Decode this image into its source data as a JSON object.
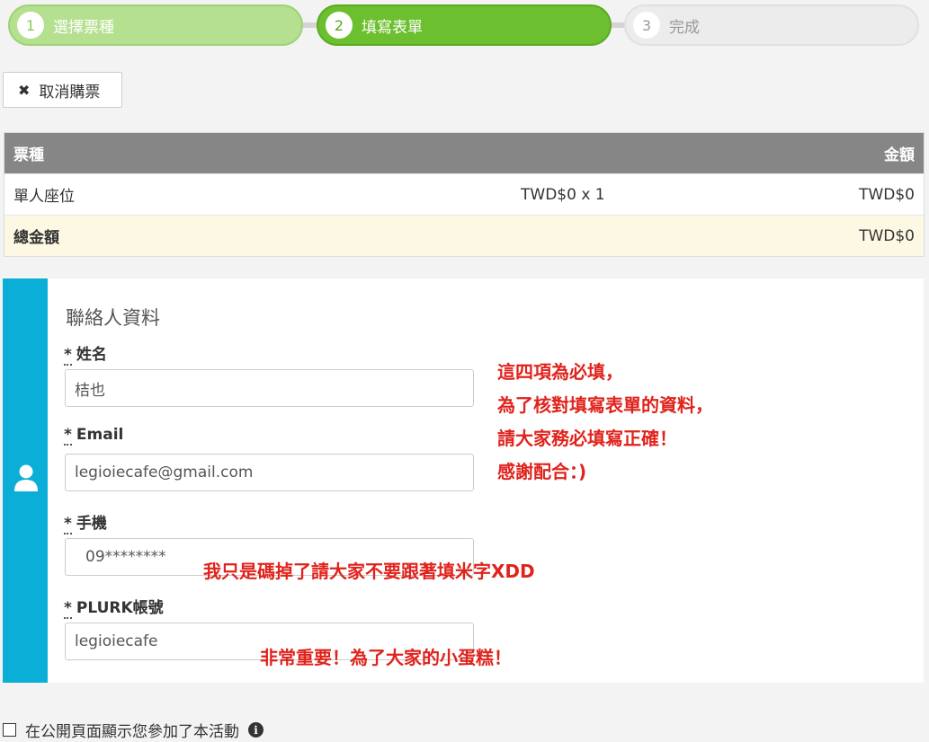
{
  "steps": [
    {
      "num": "1",
      "label": "選擇票種"
    },
    {
      "num": "2",
      "label": "填寫表單"
    },
    {
      "num": "3",
      "label": "完成"
    }
  ],
  "cancel_button": {
    "icon": "close-icon",
    "label": "取消購票"
  },
  "ticket_table": {
    "headers": {
      "type": "票種",
      "amount": "金額"
    },
    "rows": [
      {
        "type": "單人座位",
        "qty": "TWD$0 x 1",
        "amount": "TWD$0"
      }
    ],
    "total": {
      "label": "總金額",
      "amount": "TWD$0"
    }
  },
  "contact": {
    "title": "聯絡人資料",
    "fields": [
      {
        "required": "*",
        "label": "姓名",
        "value": "桔也"
      },
      {
        "required": "*",
        "label": "Email",
        "value": "legioiecafe@gmail.com"
      },
      {
        "required": "*",
        "label": "手機",
        "value": "09********"
      },
      {
        "required": "*",
        "label": "PLURK帳號",
        "value": "legioiecafe"
      }
    ],
    "annotations": {
      "required_note": [
        "這四項為必填，",
        "為了核對填寫表單的資料，",
        "請大家務必填寫正確！",
        "感謝配合：)"
      ],
      "phone_note": "我只是碼掉了請大家不要跟著填米字XDD",
      "plurk_note": "非常重要！為了大家的小蛋糕！"
    }
  },
  "public_display": {
    "label": "在公開頁面顯示您參加了本活動",
    "checked": false,
    "icon": "info-icon"
  },
  "colors": {
    "step_done": "#b4e08f",
    "step_active": "#6cbf2e",
    "step_pending": "#ececec",
    "panel_bar": "#0aaed6",
    "annotation": "#e0231c"
  }
}
